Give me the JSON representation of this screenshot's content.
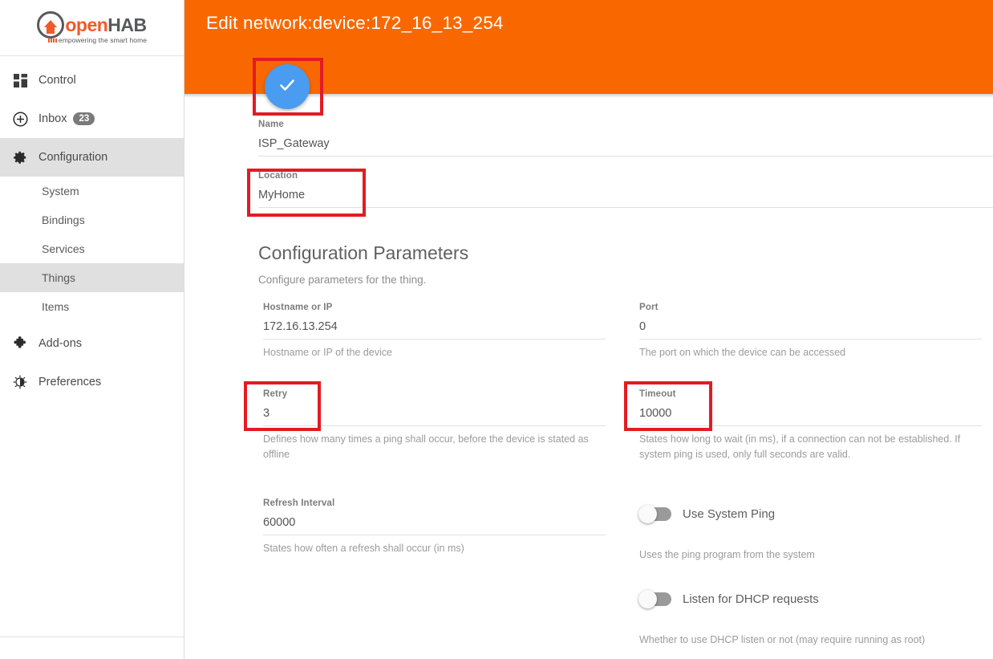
{
  "brand": {
    "name_open": "open",
    "name_hab": "HAB",
    "tagline": "empowering the smart home"
  },
  "sidebar": {
    "items": [
      {
        "label": "Control",
        "icon": "grid-icon",
        "active": false
      },
      {
        "label": "Inbox",
        "icon": "plus-circle-icon",
        "badge": "23",
        "active": false
      },
      {
        "label": "Configuration",
        "icon": "gear-icon",
        "active": true
      },
      {
        "label": "Add-ons",
        "icon": "puzzle-icon",
        "active": false
      },
      {
        "label": "Preferences",
        "icon": "brightness-icon",
        "active": false
      }
    ],
    "sub_items": [
      {
        "label": "System",
        "active": false
      },
      {
        "label": "Bindings",
        "active": false
      },
      {
        "label": "Services",
        "active": false
      },
      {
        "label": "Things",
        "active": true
      },
      {
        "label": "Items",
        "active": false
      }
    ]
  },
  "header": {
    "title": "Edit network:device:172_16_13_254",
    "background_color": "#f96800"
  },
  "fab": {
    "icon": "check-icon",
    "color": "#4a9cf0"
  },
  "annotation": {
    "color": "#e31b23"
  },
  "form": {
    "name": {
      "label": "Name",
      "value": "ISP_Gateway"
    },
    "location": {
      "label": "Location",
      "value": "MyHome"
    }
  },
  "config_section": {
    "title": "Configuration Parameters",
    "subtitle": "Configure parameters for the thing."
  },
  "parameters": {
    "hostname": {
      "label": "Hostname or IP",
      "value": "172.16.13.254",
      "help": "Hostname or IP of the device"
    },
    "port": {
      "label": "Port",
      "value": "0",
      "help": "The port on which the device can be accessed"
    },
    "retry": {
      "label": "Retry",
      "value": "3",
      "help": "Defines how many times a ping shall occur, before the device is stated as offline"
    },
    "timeout": {
      "label": "Timeout",
      "value": "10000",
      "help": "States how long to wait (in ms), if a connection can not be established. If system ping is used, only full seconds are valid."
    },
    "refresh_interval": {
      "label": "Refresh Interval",
      "value": "60000",
      "help": "States how often a refresh shall occur (in ms)"
    },
    "use_system_ping": {
      "label": "Use System Ping",
      "state": "off",
      "help": "Uses the ping program from the system"
    },
    "listen_dhcp": {
      "label": "Listen for DHCP requests",
      "state": "off",
      "help": "Whether to use DHCP listen or not (may require running as root)"
    }
  }
}
